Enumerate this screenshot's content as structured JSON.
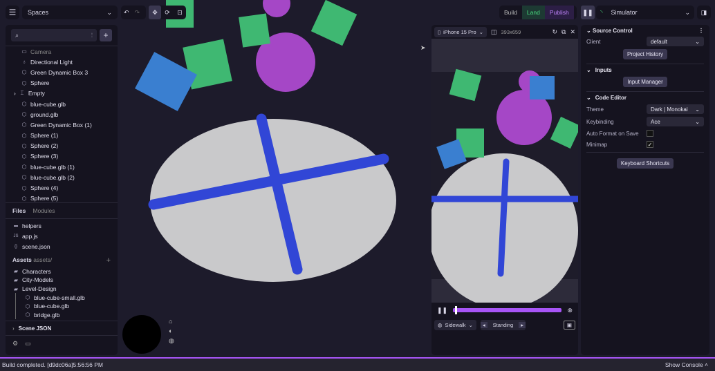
{
  "topbar": {
    "spaces_label": "Spaces",
    "build": "Build",
    "land": "Land",
    "publish": "Publish",
    "simulator": "Simulator"
  },
  "scene_tree": {
    "items": [
      {
        "label": "Camera",
        "icon": "camera-icon"
      },
      {
        "label": "Directional Light",
        "icon": "lightbulb-icon"
      },
      {
        "label": "Green Dynamic Box 3",
        "icon": "cube-icon"
      },
      {
        "label": "Sphere",
        "icon": "cube-icon"
      },
      {
        "label": "Empty",
        "icon": "frame-icon"
      },
      {
        "label": "blue-cube.glb",
        "icon": "cube-icon"
      },
      {
        "label": "ground.glb",
        "icon": "cube-icon"
      },
      {
        "label": "Green Dynamic Box (1)",
        "icon": "cube-icon"
      },
      {
        "label": "Sphere (1)",
        "icon": "cube-icon"
      },
      {
        "label": "Sphere (2)",
        "icon": "cube-icon"
      },
      {
        "label": "Sphere (3)",
        "icon": "cube-icon"
      },
      {
        "label": "blue-cube.glb (1)",
        "icon": "cube-icon"
      },
      {
        "label": "blue-cube.glb (2)",
        "icon": "cube-icon"
      },
      {
        "label": "Sphere (4)",
        "icon": "cube-icon"
      },
      {
        "label": "Sphere (5)",
        "icon": "cube-icon"
      }
    ]
  },
  "files": {
    "tab_files": "Files",
    "tab_modules": "Modules",
    "items": [
      {
        "label": "helpers",
        "icon": "folder-icon"
      },
      {
        "label": "app.js",
        "icon": "js-icon"
      },
      {
        "label": "scene.json",
        "icon": "json-icon"
      }
    ],
    "assets_label": "Assets",
    "assets_path": "assets/",
    "folders": [
      "Characters",
      "City-Models",
      "Level-Design"
    ],
    "level_items": [
      "blue-cube-small.glb",
      "blue-cube.glb",
      "bridge.glb"
    ],
    "scene_json": "Scene JSON"
  },
  "simulator": {
    "device": "iPhone 15 Pro",
    "resolution": "393x659",
    "location": "Sidewalk",
    "pose": "Standing",
    "progress": 0.02
  },
  "right": {
    "source_control": "Source Control",
    "client_label": "Client",
    "client_value": "default",
    "project_history": "Project History",
    "inputs": "Inputs",
    "input_manager": "Input Manager",
    "code_editor": "Code Editor",
    "theme_label": "Theme",
    "theme_value": "Dark | Monokai",
    "keybinding_label": "Keybinding",
    "keybinding_value": "Ace",
    "auto_format_label": "Auto Format on Save",
    "auto_format": false,
    "minimap_label": "Minimap",
    "minimap": true,
    "keyboard_shortcuts": "Keyboard Shortcuts"
  },
  "status": {
    "message": "Build completed. [d9dc06a]5:56:56 PM",
    "show_console": "Show Console"
  },
  "colors": {
    "accent": "#a855f7",
    "land": "#4ade80",
    "publish": "#c084fc"
  }
}
